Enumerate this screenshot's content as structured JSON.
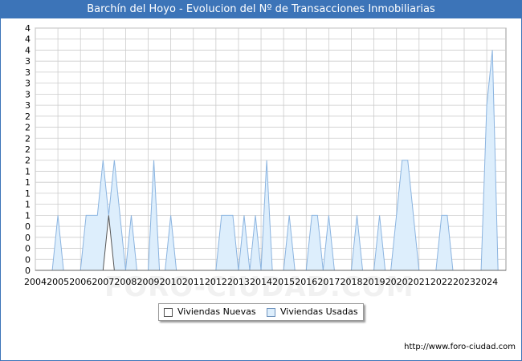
{
  "header": {
    "title": "Barchín del Hoyo - Evolucion del Nº de Transacciones Inmobiliarias"
  },
  "legend": {
    "nuevas_label": "Viviendas Nuevas",
    "usadas_label": "Viviendas Usadas"
  },
  "footer": {
    "url": "http://www.foro-ciudad.com",
    "watermark": "FORO-CIUDAD.COM"
  },
  "colors": {
    "nuevas_fill": "#ffffff",
    "nuevas_stroke": "#555555",
    "usadas_fill": "#ddeefc",
    "usadas_stroke": "#8bb4e0",
    "title_bg": "#3c74b8",
    "grid": "#cccccc"
  },
  "chart_data": {
    "type": "area",
    "title": "Barchín del Hoyo - Evolucion del Nº de Transacciones Inmobiliarias",
    "xlabel": "",
    "ylabel": "",
    "xlim": [
      2004,
      2024.85
    ],
    "ylim": [
      0,
      4.4
    ],
    "x_ticks": [
      2004,
      2005,
      2006,
      2007,
      2008,
      2009,
      2010,
      2011,
      2012,
      2013,
      2014,
      2015,
      2016,
      2017,
      2018,
      2019,
      2020,
      2021,
      2022,
      2023,
      2024
    ],
    "y_tick_values": [
      0,
      0.2,
      0.4,
      0.6,
      0.8,
      1,
      1.2,
      1.4,
      1.6,
      1.8,
      2,
      2.2,
      2.4,
      2.6,
      2.8,
      3,
      3.2,
      3.4,
      3.6,
      3.8,
      4,
      4.2,
      4.4
    ],
    "y_tick_labels": [
      "0",
      "0",
      "0",
      "0",
      "0",
      "1",
      "1",
      "1",
      "1",
      "1",
      "2",
      "2",
      "2",
      "2",
      "2",
      "3",
      "3",
      "3",
      "3",
      "3",
      "4",
      "4",
      "4"
    ],
    "grid": true,
    "legend_position": "bottom-center",
    "series": [
      {
        "name": "Viviendas Nuevas",
        "points": [
          [
            2007,
            0
          ],
          [
            2007.25,
            1
          ],
          [
            2007.5,
            0
          ]
        ]
      },
      {
        "name": "Viviendas Usadas",
        "points": [
          [
            2004.75,
            0
          ],
          [
            2005,
            1
          ],
          [
            2005.25,
            0
          ],
          [
            2006,
            0
          ],
          [
            2006.25,
            1
          ],
          [
            2006.75,
            1
          ],
          [
            2007,
            2
          ],
          [
            2007.25,
            1
          ],
          [
            2007.5,
            2
          ],
          [
            2008,
            0
          ],
          [
            2008,
            0
          ],
          [
            2008.25,
            1
          ],
          [
            2008.5,
            0
          ],
          [
            2009,
            0
          ],
          [
            2009.25,
            2
          ],
          [
            2009.5,
            0
          ],
          [
            2009.75,
            0
          ],
          [
            2010,
            1
          ],
          [
            2010.25,
            0
          ],
          [
            2012,
            0
          ],
          [
            2012.25,
            1
          ],
          [
            2012.75,
            1
          ],
          [
            2013,
            0
          ],
          [
            2013.25,
            1
          ],
          [
            2013.5,
            0
          ],
          [
            2013.75,
            1
          ],
          [
            2014,
            0
          ],
          [
            2014.25,
            2
          ],
          [
            2014.5,
            0
          ],
          [
            2015,
            0
          ],
          [
            2015.25,
            1
          ],
          [
            2015.5,
            0
          ],
          [
            2016,
            0
          ],
          [
            2016.25,
            1
          ],
          [
            2016.5,
            1
          ],
          [
            2016.75,
            0
          ],
          [
            2017,
            1
          ],
          [
            2017.25,
            0
          ],
          [
            2018,
            0
          ],
          [
            2018.25,
            1
          ],
          [
            2018.5,
            0
          ],
          [
            2019,
            0
          ],
          [
            2019.25,
            1
          ],
          [
            2019.5,
            0
          ],
          [
            2019.75,
            0
          ],
          [
            2020,
            1
          ],
          [
            2020.25,
            2
          ],
          [
            2020.5,
            2
          ],
          [
            2020.75,
            1
          ],
          [
            2021,
            0
          ],
          [
            2021.75,
            0
          ],
          [
            2022,
            1
          ],
          [
            2022.25,
            1
          ],
          [
            2022.5,
            0
          ],
          [
            2023.75,
            0
          ],
          [
            2024,
            3
          ],
          [
            2024.25,
            4
          ],
          [
            2024.5,
            0
          ]
        ]
      }
    ]
  }
}
